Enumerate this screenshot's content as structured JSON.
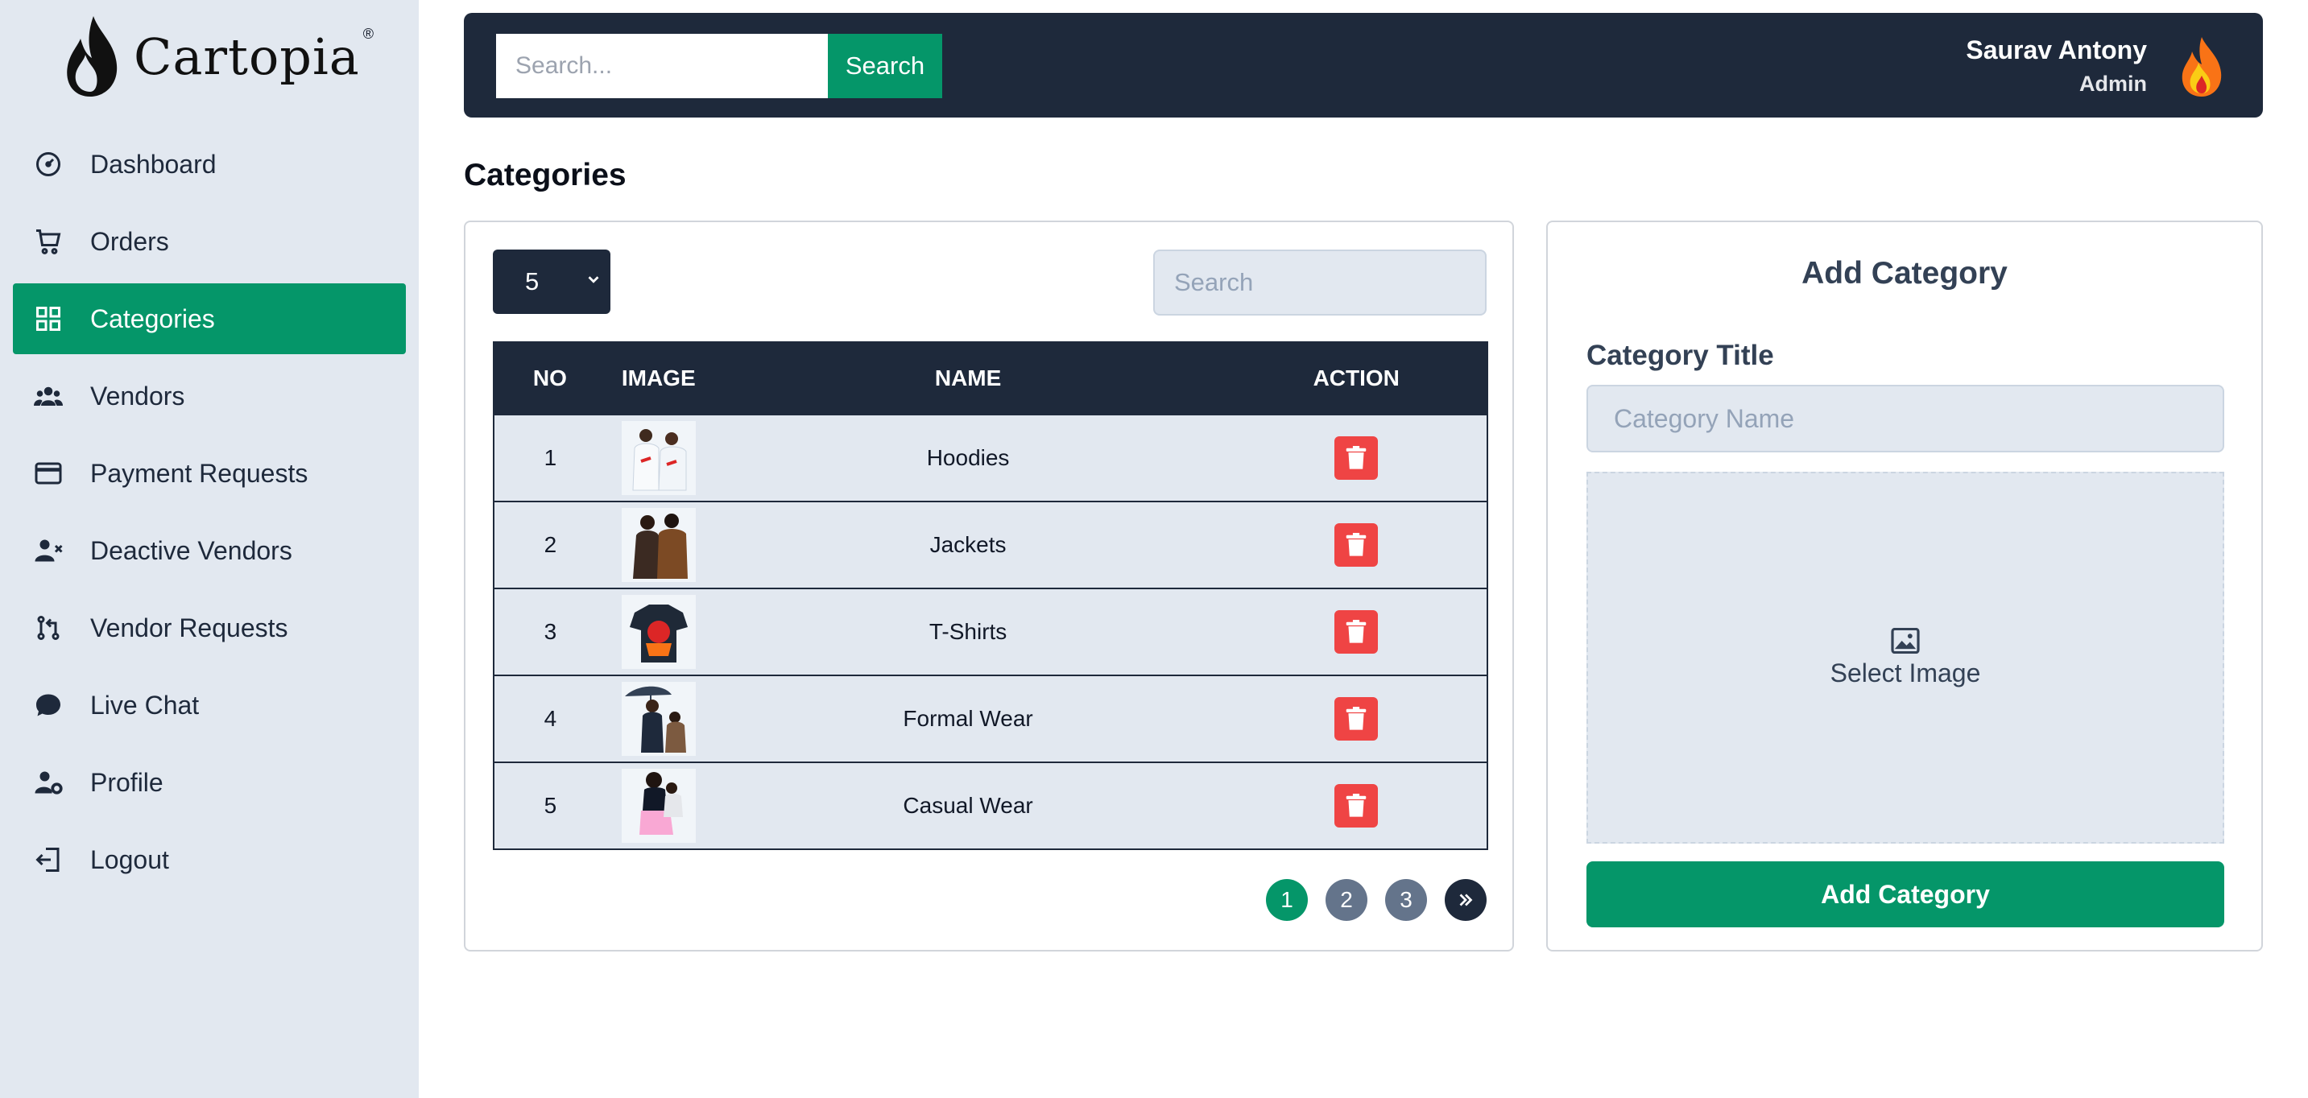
{
  "brand": {
    "name": "Cartopia",
    "registered_mark": "®"
  },
  "sidebar": {
    "items": [
      {
        "label": "Dashboard",
        "icon": "dashboard-gauge-icon",
        "active": false
      },
      {
        "label": "Orders",
        "icon": "shopping-cart-icon",
        "active": false
      },
      {
        "label": "Categories",
        "icon": "grid-icon",
        "active": true
      },
      {
        "label": "Vendors",
        "icon": "users-icon",
        "active": false
      },
      {
        "label": "Payment Requests",
        "icon": "credit-card-icon",
        "active": false
      },
      {
        "label": "Deactive Vendors",
        "icon": "user-x-icon",
        "active": false
      },
      {
        "label": "Vendor Requests",
        "icon": "pull-request-icon",
        "active": false
      },
      {
        "label": "Live Chat",
        "icon": "chat-bubble-icon",
        "active": false
      },
      {
        "label": "Profile",
        "icon": "user-gear-icon",
        "active": false
      },
      {
        "label": "Logout",
        "icon": "logout-icon",
        "active": false
      }
    ]
  },
  "header": {
    "search_placeholder": "Search...",
    "search_button": "Search",
    "user_name": "Saurav Antony",
    "user_role": "Admin"
  },
  "page": {
    "title": "Categories"
  },
  "list": {
    "per_page": "5",
    "search_placeholder": "Search",
    "columns": [
      "NO",
      "IMAGE",
      "NAME",
      "ACTION"
    ],
    "rows": [
      {
        "no": "1",
        "name": "Hoodies",
        "image": "hoodies-thumbnail"
      },
      {
        "no": "2",
        "name": "Jackets",
        "image": "jackets-thumbnail"
      },
      {
        "no": "3",
        "name": "T-Shirts",
        "image": "tshirts-thumbnail"
      },
      {
        "no": "4",
        "name": "Formal Wear",
        "image": "formal-wear-thumbnail"
      },
      {
        "no": "5",
        "name": "Casual Wear",
        "image": "casual-wear-thumbnail"
      }
    ],
    "pagination": {
      "pages": [
        "1",
        "2",
        "3"
      ],
      "current": "1",
      "next_icon": "chevrons-right-icon"
    }
  },
  "add_category": {
    "title": "Add Category",
    "field_label": "Category Title",
    "name_placeholder": "Category Name",
    "select_image": "Select Image",
    "submit": "Add Category"
  },
  "colors": {
    "accent": "#059669",
    "dark": "#1e293b",
    "sidebar_bg": "#e2e8f0",
    "danger": "#ef4444"
  }
}
